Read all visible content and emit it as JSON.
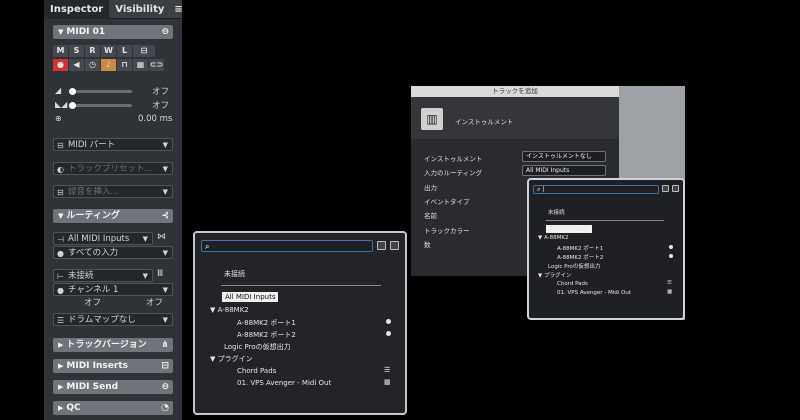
{
  "inspector": {
    "tabs": [
      "Inspector",
      "Visibility"
    ],
    "menu_icon": "≡",
    "track_name": "MIDI 01",
    "buttons_row1": [
      "M",
      "S",
      "R",
      "W",
      "L"
    ],
    "volume_value": "オフ",
    "pan_value": "オフ",
    "delay_value": "0.00 ms",
    "midi_part": "MIDI パート",
    "track_preset_placeholder": "トラックプリセット...",
    "insert_sound_placeholder": "録音を挿入...",
    "routing_section": "ルーティング",
    "input": "All MIDI Inputs",
    "input_channel": "すべての入力",
    "output": "未接続",
    "channel": "チャンネル 1",
    "bank": "オフ",
    "program": "オフ",
    "drummap": "ドラムマップなし",
    "sections": [
      "トラックバージョン",
      "MIDI Inserts",
      "MIDI Send",
      "QC"
    ]
  },
  "popup": {
    "unconnected": "未接続",
    "selected": "All MIDI Inputs",
    "device": "A-88MK2",
    "ports": [
      "A-88MK2 ポート1",
      "A-88MK2 ポート2"
    ],
    "virtual": "Logic Proの仮想出力",
    "plugins": "プラグイン",
    "plugin_items": [
      "Chord Pads",
      "01. VPS Avenger - Midi Out"
    ]
  },
  "dialog": {
    "title": "トラックを追加",
    "type": "インストゥルメント",
    "labels": [
      "インストゥルメント",
      "入力のルーティング",
      "出力",
      "イベントタイプ",
      "名前",
      "トラックカラー",
      "数"
    ],
    "instrument_value": "インストゥルメントなし",
    "routing_value": "All MIDI Inputs",
    "search_value": "|"
  }
}
